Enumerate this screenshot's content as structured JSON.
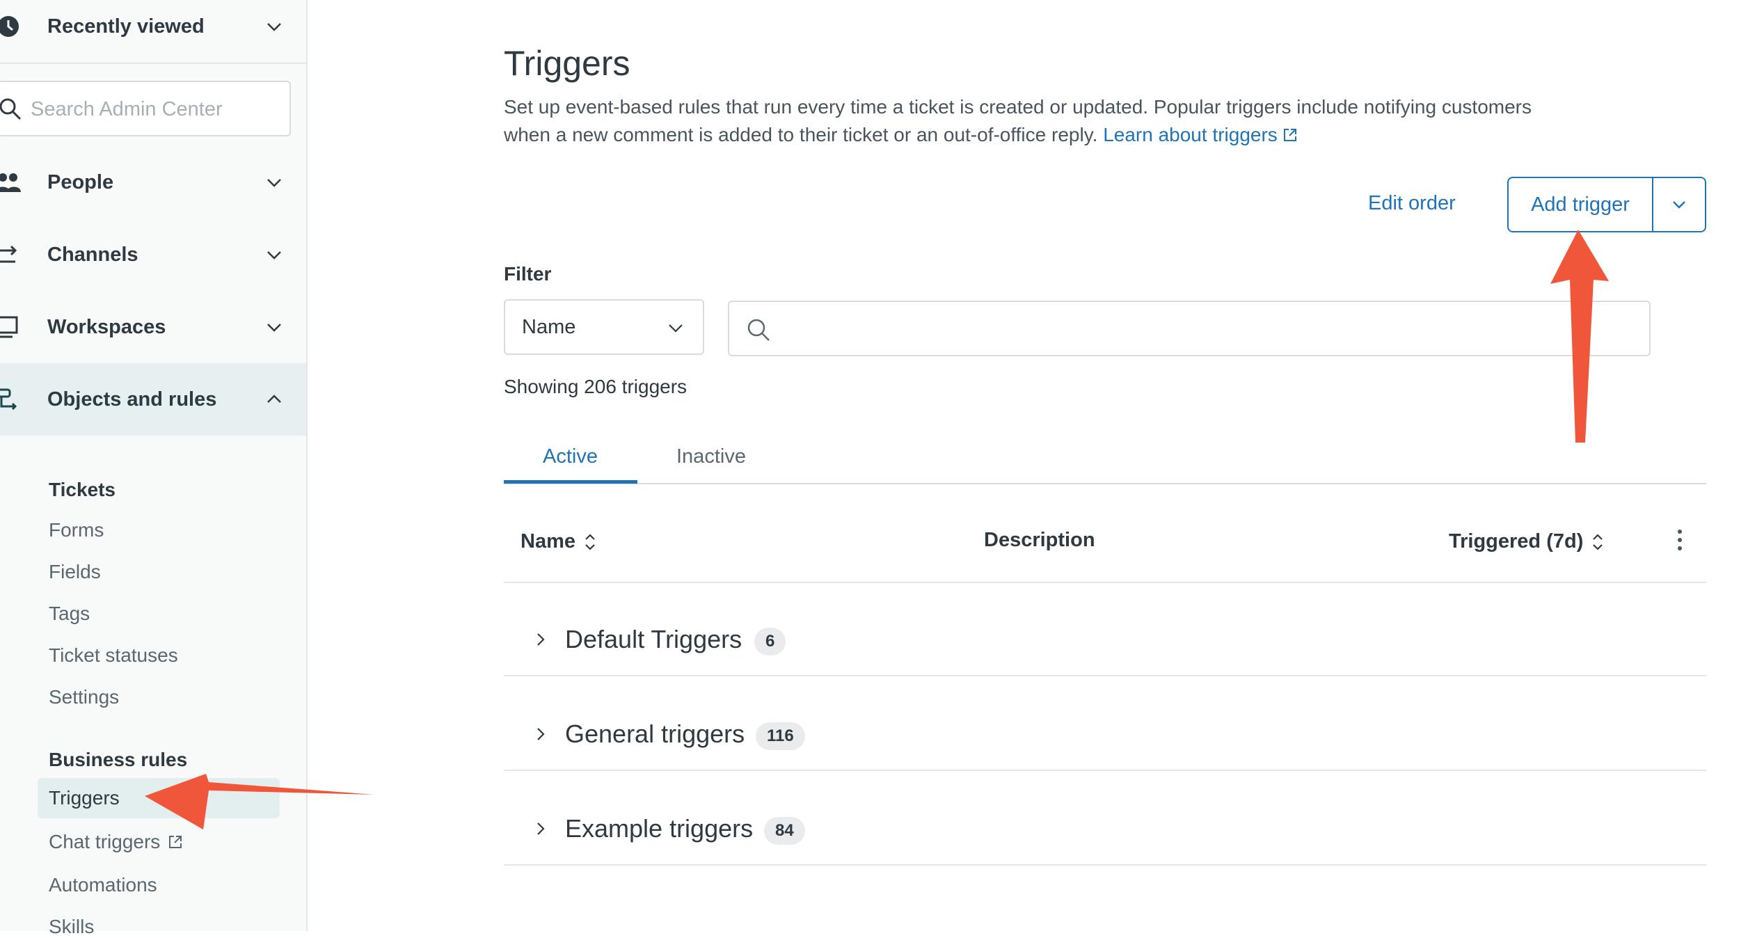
{
  "sidebar": {
    "recently_viewed": "Recently viewed",
    "search_placeholder": "Search Admin Center",
    "sections": [
      {
        "label": "People"
      },
      {
        "label": "Channels"
      },
      {
        "label": "Workspaces"
      },
      {
        "label": "Objects and rules"
      }
    ],
    "tickets_heading": "Tickets",
    "tickets_items": [
      "Forms",
      "Fields",
      "Tags",
      "Ticket statuses",
      "Settings"
    ],
    "business_rules_heading": "Business rules",
    "business_rules_items": [
      "Triggers",
      "Chat triggers",
      "Automations",
      "Skills"
    ]
  },
  "main": {
    "title": "Triggers",
    "description": "Set up event-based rules that run every time a ticket is created or updated. Popular triggers include notifying customers when a new comment is added to their ticket or an out-of-office reply.",
    "learn_link": "Learn about triggers",
    "edit_order": "Edit order",
    "add_trigger": "Add trigger",
    "filter_label": "Filter",
    "filter_select_value": "Name",
    "showing": "Showing 206 triggers",
    "tabs": [
      "Active",
      "Inactive"
    ],
    "columns": [
      "Name",
      "Description",
      "Triggered (7d)"
    ],
    "groups": [
      {
        "name": "Default Triggers",
        "count": "6"
      },
      {
        "name": "General triggers",
        "count": "116"
      },
      {
        "name": "Example triggers",
        "count": "84"
      }
    ]
  },
  "colors": {
    "accent": "#1f73b7",
    "annotation_arrow": "#f0563a",
    "sidebar_active": "#e6f0f0"
  }
}
